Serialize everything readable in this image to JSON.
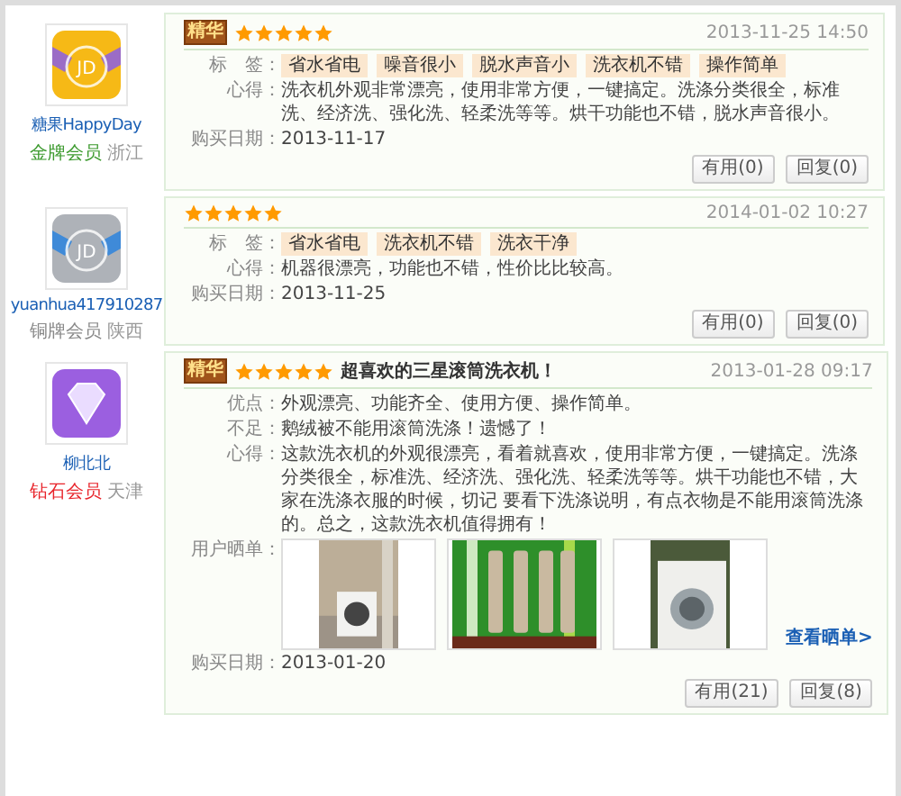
{
  "reviews": [
    {
      "user": {
        "name": "糖果HappyDay",
        "avatar": {
          "kind": "gold",
          "text": "JD"
        },
        "level": "金牌会员",
        "color": "#3c9a2e",
        "region": "浙江"
      },
      "badge": "精华",
      "stars": 5,
      "time": "2013-11-25 14:50",
      "fields": [
        {
          "kind": "tags",
          "label": "标　签：",
          "tags": [
            "省水省电",
            "噪音很小",
            "脱水声音小",
            "洗衣机不错",
            "操作简单"
          ]
        },
        {
          "kind": "text",
          "label": "心得：",
          "text": "洗衣机外观非常漂亮，使用非常方便，一键搞定。洗涤分类很全，标准洗、经济洗、强化洗、轻柔洗等等。烘干功能也不错，脱水声音很小。"
        }
      ],
      "purchase_label": "购买日期：",
      "purchase_date": "2013-11-17",
      "buttons": [
        "有用(0)",
        "回复(0)"
      ]
    },
    {
      "user": {
        "name": "yuanhua417910287",
        "avatar": {
          "kind": "silver",
          "text": "JD"
        },
        "level": "铜牌会员",
        "color": "#888888",
        "region": "陕西"
      },
      "stars": 5,
      "time": "2014-01-02 10:27",
      "fields": [
        {
          "kind": "tags",
          "label": "标　签：",
          "tags": [
            "省水省电",
            "洗衣机不错",
            "洗衣干净"
          ]
        },
        {
          "kind": "text",
          "label": "心得：",
          "text": "机器很漂亮，功能也不错，性价比比较高。"
        }
      ],
      "purchase_label": "购买日期：",
      "purchase_date": "2013-11-25",
      "buttons": [
        "有用(0)",
        "回复(0)"
      ]
    },
    {
      "user": {
        "name": "柳北北",
        "avatar": {
          "kind": "diamond"
        },
        "level": "钻石会员",
        "color": "#e8242b",
        "region": "天津"
      },
      "badge": "精华",
      "stars": 5,
      "title": "超喜欢的三星滚筒洗衣机！",
      "time": "2013-01-28 09:17",
      "fields": [
        {
          "kind": "text",
          "label": "优点：",
          "text": "外观漂亮、功能齐全、使用方便、操作简单。"
        },
        {
          "kind": "text",
          "label": "不足：",
          "text": "鹅绒被不能用滚筒洗涤！遗憾了！"
        },
        {
          "kind": "text",
          "label": "心得：",
          "text": "这款洗衣机的外观很漂亮，看着就喜欢，使用非常方便，一键搞定。洗涤分类很全，标准洗、经济洗、强化洗、轻柔洗等等。烘干功能也不错，大家在洗涤衣服的时候，切记 要看下洗涤说明，有点衣物是不能用滚筒洗涤的。总之，这款洗衣机值得拥有！"
        },
        {
          "kind": "photos",
          "label": "用户晒单：",
          "link": "查看晒单>"
        }
      ],
      "purchase_label": "购买日期：",
      "purchase_date": "2013-01-20",
      "buttons": [
        "有用(21)",
        "回复(8)"
      ]
    }
  ]
}
